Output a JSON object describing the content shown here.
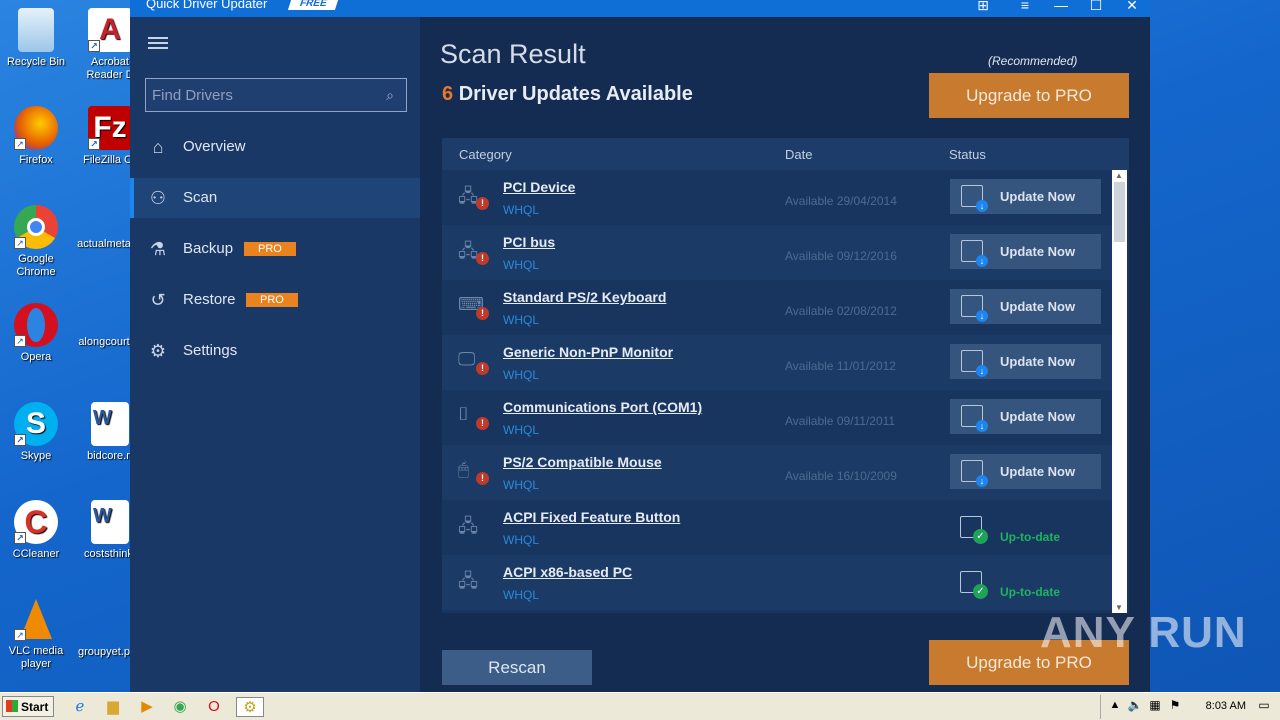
{
  "desktop": {
    "icons": [
      {
        "label": "Recycle Bin",
        "icon": "recycle-bin-icon",
        "color": "#9cc6e8"
      },
      {
        "label": "Acrobat Reader D",
        "icon": "acrobat-icon",
        "color": "#c8202a"
      },
      {
        "label": "Firefox",
        "icon": "firefox-icon",
        "color": "#e66000"
      },
      {
        "label": "FileZilla Cli",
        "icon": "filezilla-icon",
        "color": "#bf0000"
      },
      {
        "label": "Google Chrome",
        "icon": "chrome-icon",
        "color": "#34a853"
      },
      {
        "label": "actualmeta",
        "icon": "file-icon",
        "color": "#ffffff"
      },
      {
        "label": "Opera",
        "icon": "opera-icon",
        "color": "#d40f1e"
      },
      {
        "label": "alongcourt",
        "icon": "file-icon",
        "color": "#ffffff"
      },
      {
        "label": "Skype",
        "icon": "skype-icon",
        "color": "#00aff0"
      },
      {
        "label": "bidcore.rt",
        "icon": "word-doc-icon",
        "color": "#2b579a"
      },
      {
        "label": "CCleaner",
        "icon": "ccleaner-icon",
        "color": "#d93025"
      },
      {
        "label": "coststhink.",
        "icon": "word-doc-icon",
        "color": "#2b579a"
      },
      {
        "label": "VLC media player",
        "icon": "vlc-icon",
        "color": "#f08a00"
      },
      {
        "label": "groupyet.p",
        "icon": "file-icon",
        "color": "#ffffff"
      }
    ]
  },
  "window": {
    "title": "Quick Driver Updater",
    "badge": "FREE"
  },
  "sidebar": {
    "search_placeholder": "Find Drivers",
    "items": [
      {
        "label": "Overview",
        "icon": "home-icon",
        "pro": ""
      },
      {
        "label": "Scan",
        "icon": "scan-user-icon",
        "pro": ""
      },
      {
        "label": "Backup",
        "icon": "flask-icon",
        "pro": "PRO"
      },
      {
        "label": "Restore",
        "icon": "history-icon",
        "pro": "PRO"
      },
      {
        "label": "Settings",
        "icon": "gear-icon",
        "pro": ""
      }
    ]
  },
  "main": {
    "title": "Scan Result",
    "count": "6",
    "subtitle": "Driver Updates Available",
    "recommended": "(Recommended)",
    "upgrade_label": "Upgrade to PRO",
    "columns": [
      "Category",
      "Date",
      "Status"
    ],
    "rows": [
      {
        "name": "PCI Device",
        "tag": "WHQL",
        "date": "Available 29/04/2014",
        "status": "Update Now"
      },
      {
        "name": "PCI bus",
        "tag": "WHQL",
        "date": "Available 09/12/2016",
        "status": "Update Now"
      },
      {
        "name": "Standard PS/2 Keyboard",
        "tag": "WHQL",
        "date": "Available 02/08/2012",
        "status": "Update Now"
      },
      {
        "name": "Generic Non-PnP Monitor",
        "tag": "WHQL",
        "date": "Available 11/01/2012",
        "status": "Update Now"
      },
      {
        "name": "Communications Port (COM1)",
        "tag": "WHQL",
        "date": "Available 09/11/2011",
        "status": "Update Now"
      },
      {
        "name": "PS/2 Compatible Mouse",
        "tag": "WHQL",
        "date": "Available 16/10/2009",
        "status": "Update Now"
      },
      {
        "name": "ACPI Fixed Feature Button",
        "tag": "WHQL",
        "date": "",
        "status": "Up-to-date"
      },
      {
        "name": "ACPI x86-based PC",
        "tag": "WHQL",
        "date": "",
        "status": "Up-to-date"
      }
    ],
    "rescan_label": "Rescan"
  },
  "watermark": "ANY RUN",
  "taskbar": {
    "start_label": "Start",
    "clock": "8:03 AM"
  }
}
